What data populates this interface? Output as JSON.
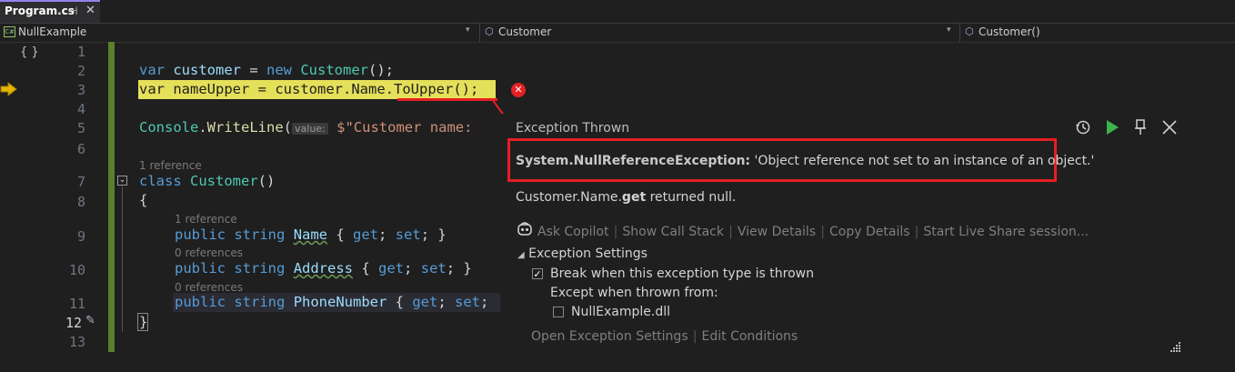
{
  "tab": {
    "title": "Program.cs",
    "pin": "⊣",
    "close": "✕"
  },
  "nav": {
    "project": "NullExample",
    "class": "Customer",
    "member": "Customer()"
  },
  "lines": [
    "1",
    "2",
    "3",
    "4",
    "5",
    "6",
    "7",
    "8",
    "9",
    "10",
    "11",
    "12",
    "13"
  ],
  "code": {
    "l2": {
      "kw": "var",
      "id": "customer",
      "eq": " = ",
      "kw2": "new",
      "ty": "Customer",
      "rest": "();"
    },
    "l3": {
      "kw": "var",
      "id": "nameUpper",
      "eq": " = ",
      "id2": "customer",
      "d1": ".",
      "id3": "Name",
      "d2": ".",
      "fn": "ToUpper",
      "rest": "();"
    },
    "l5": {
      "ty": "Console",
      "d": ".",
      "fn": "WriteLine",
      "p": "(",
      "hint": "value:",
      "st": "$\"Customer name: "
    },
    "refs": {
      "r7": "1 reference",
      "r9": "1 reference",
      "r10": "0 references",
      "r11": "0 references"
    },
    "l7": {
      "kw": "class",
      "ty": "Customer",
      "rest": "()"
    },
    "l8": "{",
    "l9": {
      "kw1": "public",
      "kw2": "string",
      "id": "Name",
      "b1": " { ",
      "g": "get",
      "s1": "; ",
      "s": "set",
      "b2": "; }"
    },
    "l10": {
      "kw1": "public",
      "kw2": "string",
      "id": "Address",
      "b1": " { ",
      "g": "get",
      "s1": "; ",
      "s": "set",
      "b2": "; }"
    },
    "l11": {
      "kw1": "public",
      "kw2": "string",
      "id": "PhoneNumber",
      "b1": " { ",
      "g": "get",
      "s1": "; ",
      "s": "set",
      "b2": ";"
    },
    "l12": "}"
  },
  "exception": {
    "title": "Exception Thrown",
    "type": "System.NullReferenceException:",
    "message": " 'Object reference not set to an instance of an object.'",
    "detail_prefix": "Customer.Name.",
    "detail_bold": "get",
    "detail_suffix": " returned null.",
    "actions": [
      "Ask Copilot",
      "Show Call Stack",
      "View Details",
      "Copy Details",
      "Start Live Share session..."
    ],
    "settings_header": "Exception Settings",
    "break_label": "Break when this exception type is thrown",
    "except_label": "Except when thrown from:",
    "dll_label": "NullExample.dll",
    "footer_links": [
      "Open Exception Settings",
      "Edit Conditions"
    ]
  },
  "colors": {
    "accent": "#e51f24",
    "highlight": "#e5e05a",
    "green_bar": "#59812c"
  }
}
